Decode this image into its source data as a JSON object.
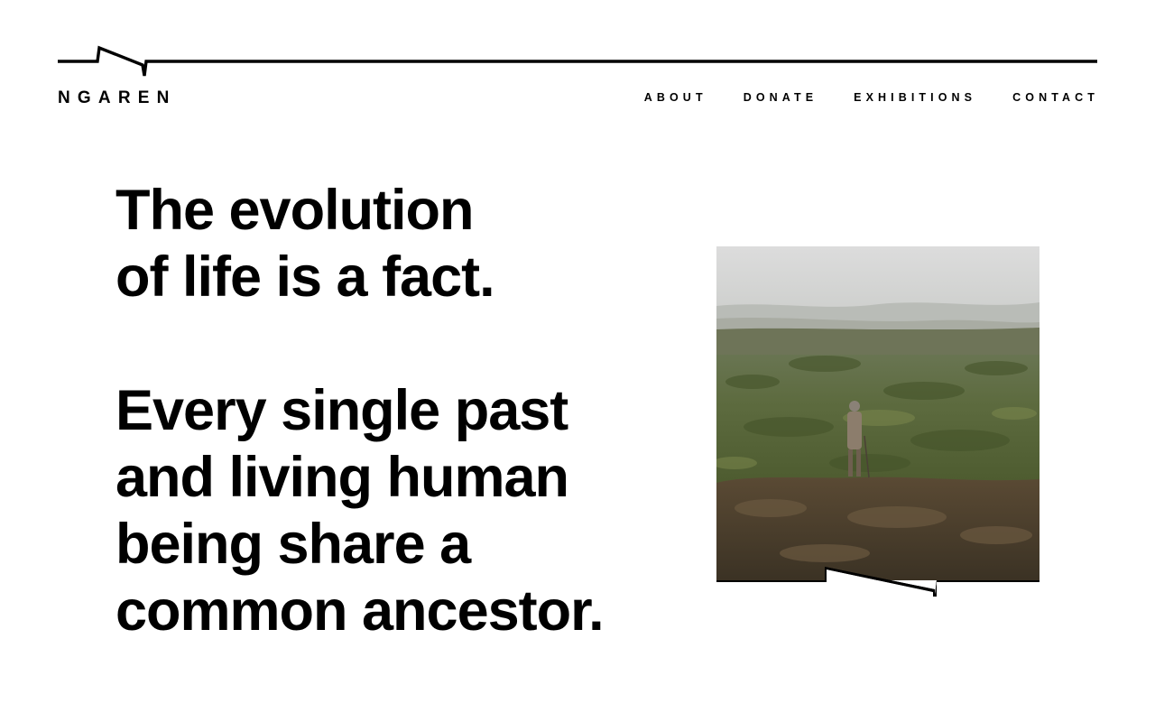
{
  "header": {
    "brand": "NGAREN",
    "nav": [
      {
        "label": "ABOUT"
      },
      {
        "label": "DONATE"
      },
      {
        "label": "EXHIBITIONS"
      },
      {
        "label": "CONTACT"
      }
    ]
  },
  "hero": {
    "lines_1": [
      "The evolution",
      "of life is a fact."
    ],
    "lines_2": [
      "Every single past",
      "and living human",
      "being share a",
      "common ancestor."
    ]
  },
  "photo": {
    "icon": "landscape-photo"
  },
  "colors": {
    "text": "#000000",
    "background": "#ffffff"
  }
}
